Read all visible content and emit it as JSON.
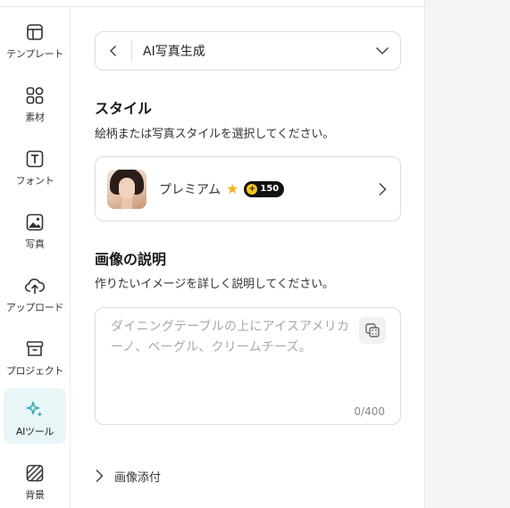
{
  "sidebar": {
    "items": [
      {
        "label": "テンプレート",
        "icon": "layout-template-icon",
        "active": false
      },
      {
        "label": "素材",
        "icon": "shapes-icon",
        "active": false
      },
      {
        "label": "フォント",
        "icon": "text-icon",
        "active": false
      },
      {
        "label": "写真",
        "icon": "image-icon",
        "active": false
      },
      {
        "label": "アップロード",
        "icon": "cloud-upload-icon",
        "active": false
      },
      {
        "label": "プロジェクト",
        "icon": "archive-box-icon",
        "active": false
      },
      {
        "label": "AIツール",
        "icon": "sparkles-icon",
        "active": true
      },
      {
        "label": "背景",
        "icon": "background-pattern-icon",
        "active": false
      }
    ]
  },
  "tool_selector": {
    "title": "AI写真生成"
  },
  "style_section": {
    "heading": "スタイル",
    "description": "絵柄または写真スタイルを選択してください。",
    "selected": {
      "name": "プレミアム",
      "badge_value": "150"
    }
  },
  "description_section": {
    "heading": "画像の説明",
    "description": "作りたいイメージを詳しく説明してください。",
    "placeholder": "ダイニングテーブルの上にアイスアメリカーノ、ベーグル、クリームチーズ。",
    "char_count": "0/400"
  },
  "attach": {
    "label": "画像添付"
  },
  "colors": {
    "active_bg": "#e8f6f8",
    "accent": "#2aa7b8",
    "star": "#f1b51c"
  }
}
